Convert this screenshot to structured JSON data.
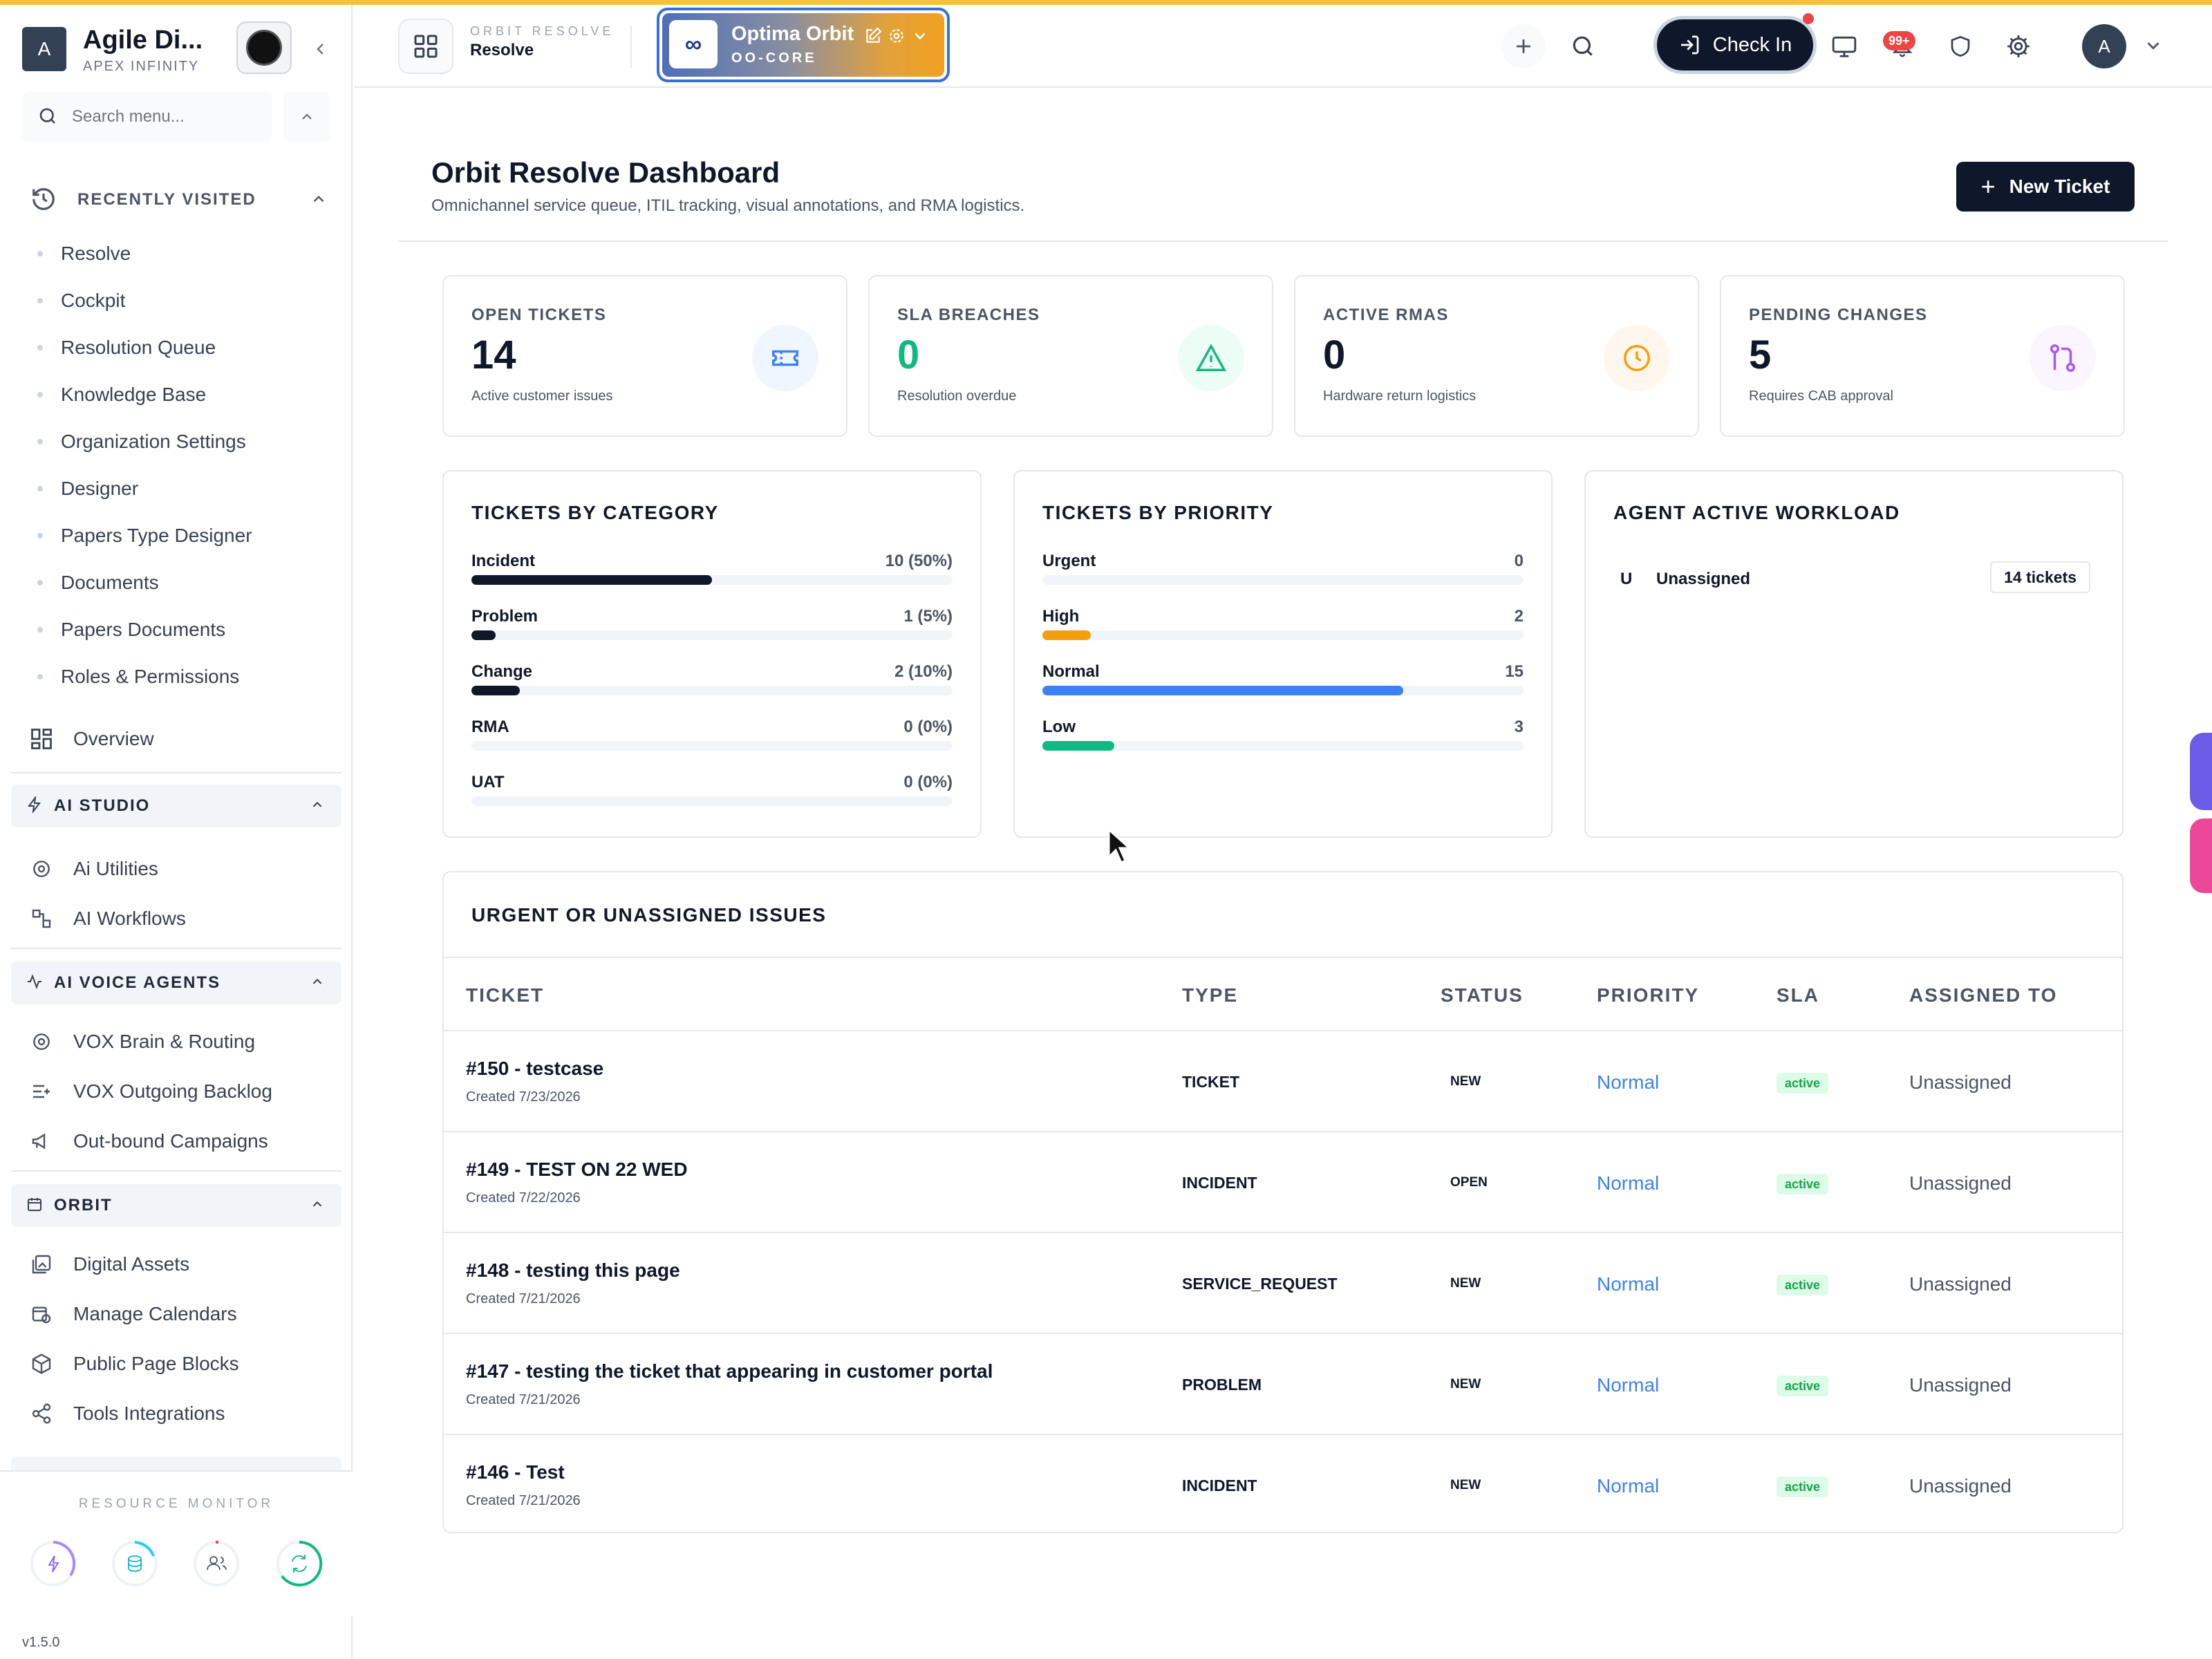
{
  "colors": {
    "accent": "#0f172a",
    "stripe": "#f6c23e",
    "green": "#10b981",
    "amber": "#f59e0b",
    "blue": "#3b82f6",
    "purple": "#a855f7"
  },
  "sidebar": {
    "org_name": "Agile Di...",
    "org_sub": "APEX INFINITY",
    "org_initial": "A",
    "search_placeholder": "Search menu...",
    "recently_visited_title": "RECENTLY VISITED",
    "recent": [
      "Resolve",
      "Cockpit",
      "Resolution Queue",
      "Knowledge Base",
      "Organization Settings",
      "Designer",
      "Papers Type Designer",
      "Documents",
      "Papers Documents",
      "Roles & Permissions"
    ],
    "overview": "Overview",
    "groups": [
      {
        "title": "AI STUDIO",
        "icon": "bolt-icon",
        "items": [
          {
            "label": "Ai Utilities",
            "icon": "cog-icon"
          },
          {
            "label": "AI Workflows",
            "icon": "workflow-icon"
          }
        ]
      },
      {
        "title": "AI VOICE AGENTS",
        "icon": "activity-icon",
        "items": [
          {
            "label": "VOX Brain & Routing",
            "icon": "cog-icon"
          },
          {
            "label": "VOX Outgoing Backlog",
            "icon": "list-add-icon"
          },
          {
            "label": "Out-bound Campaigns",
            "icon": "megaphone-icon"
          }
        ]
      },
      {
        "title": "ORBIT",
        "icon": "calendar-icon",
        "items": [
          {
            "label": "Digital Assets",
            "icon": "image-stack-icon"
          },
          {
            "label": "Manage Calendars",
            "icon": "calendar-clock-icon"
          },
          {
            "label": "Public Page Blocks",
            "icon": "box-icon"
          },
          {
            "label": "Tools Integrations",
            "icon": "share-icon"
          }
        ]
      }
    ],
    "resource_monitor": "RESOURCE MONITOR",
    "version": "v1.5.0"
  },
  "topbar": {
    "app_eyebrow": "ORBIT RESOLVE",
    "app_name": "Resolve",
    "workspace_name": "Optima Orbit",
    "workspace_code": "OO-CORE",
    "workspace_logo": "∞",
    "checkin": "Check In",
    "notif_badge": "99+",
    "avatar": "A"
  },
  "page": {
    "title": "Orbit Resolve Dashboard",
    "subtitle": "Omnichannel service queue, ITIL tracking, visual annotations, and RMA logistics.",
    "new_ticket": "New Ticket"
  },
  "kpis": [
    {
      "label": "OPEN TICKETS",
      "value": "14",
      "sub": "Active customer issues",
      "color": "#0f172a",
      "icon": "ticket-icon",
      "bg": "#eff6ff",
      "fg": "#3b82f6"
    },
    {
      "label": "SLA BREACHES",
      "value": "0",
      "sub": "Resolution overdue",
      "color": "#10b981",
      "icon": "alert-triangle-icon",
      "bg": "#ecfdf5",
      "fg": "#10b981"
    },
    {
      "label": "ACTIVE RMAS",
      "value": "0",
      "sub": "Hardware return logistics",
      "color": "#0f172a",
      "icon": "clock-icon",
      "bg": "#fff7ed",
      "fg": "#f59e0b"
    },
    {
      "label": "PENDING CHANGES",
      "value": "5",
      "sub": "Requires CAB approval",
      "color": "#0f172a",
      "icon": "git-pull-icon",
      "bg": "#faf5ff",
      "fg": "#a855f7"
    }
  ],
  "category": {
    "title": "TICKETS BY CATEGORY",
    "rows": [
      {
        "label": "Incident",
        "value": "10 (50%)",
        "fraction": 0.5,
        "color": "#0f172a"
      },
      {
        "label": "Problem",
        "value": "1 (5%)",
        "fraction": 0.05,
        "color": "#0f172a"
      },
      {
        "label": "Change",
        "value": "2 (10%)",
        "fraction": 0.1,
        "color": "#0f172a"
      },
      {
        "label": "RMA",
        "value": "0 (0%)",
        "fraction": 0,
        "color": "#0f172a"
      },
      {
        "label": "UAT",
        "value": "0 (0%)",
        "fraction": 0,
        "color": "#0f172a"
      }
    ]
  },
  "priority": {
    "title": "TICKETS BY PRIORITY",
    "rows": [
      {
        "label": "Urgent",
        "value": "0",
        "fraction": 0,
        "color": "#ef4444"
      },
      {
        "label": "High",
        "value": "2",
        "fraction": 0.1,
        "color": "#f59e0b"
      },
      {
        "label": "Normal",
        "value": "15",
        "fraction": 0.75,
        "color": "#3b82f6"
      },
      {
        "label": "Low",
        "value": "3",
        "fraction": 0.15,
        "color": "#10b981"
      }
    ]
  },
  "workload": {
    "title": "AGENT ACTIVE WORKLOAD",
    "rows": [
      {
        "initial": "U",
        "name": "Unassigned",
        "count": "14 tickets"
      }
    ]
  },
  "issues": {
    "title": "URGENT OR UNASSIGNED ISSUES",
    "columns": [
      "TICKET",
      "TYPE",
      "STATUS",
      "PRIORITY",
      "SLA",
      "ASSIGNED TO"
    ],
    "rows": [
      {
        "title": "#150 - testcase",
        "created": "Created 7/23/2026",
        "type": "TICKET",
        "status": "NEW",
        "priority": "Normal",
        "sla": "active",
        "assigned": "Unassigned"
      },
      {
        "title": "#149 - TEST ON 22 WED",
        "created": "Created 7/22/2026",
        "type": "INCIDENT",
        "status": "OPEN",
        "priority": "Normal",
        "sla": "active",
        "assigned": "Unassigned"
      },
      {
        "title": "#148 - testing this page",
        "created": "Created 7/21/2026",
        "type": "SERVICE_REQUEST",
        "status": "NEW",
        "priority": "Normal",
        "sla": "active",
        "assigned": "Unassigned"
      },
      {
        "title": "#147 - testing the ticket that appearing in customer portal",
        "created": "Created 7/21/2026",
        "type": "PROBLEM",
        "status": "NEW",
        "priority": "Normal",
        "sla": "active",
        "assigned": "Unassigned"
      },
      {
        "title": "#146 - Test",
        "created": "Created 7/21/2026",
        "type": "INCIDENT",
        "status": "NEW",
        "priority": "Normal",
        "sla": "active",
        "assigned": "Unassigned"
      }
    ]
  }
}
